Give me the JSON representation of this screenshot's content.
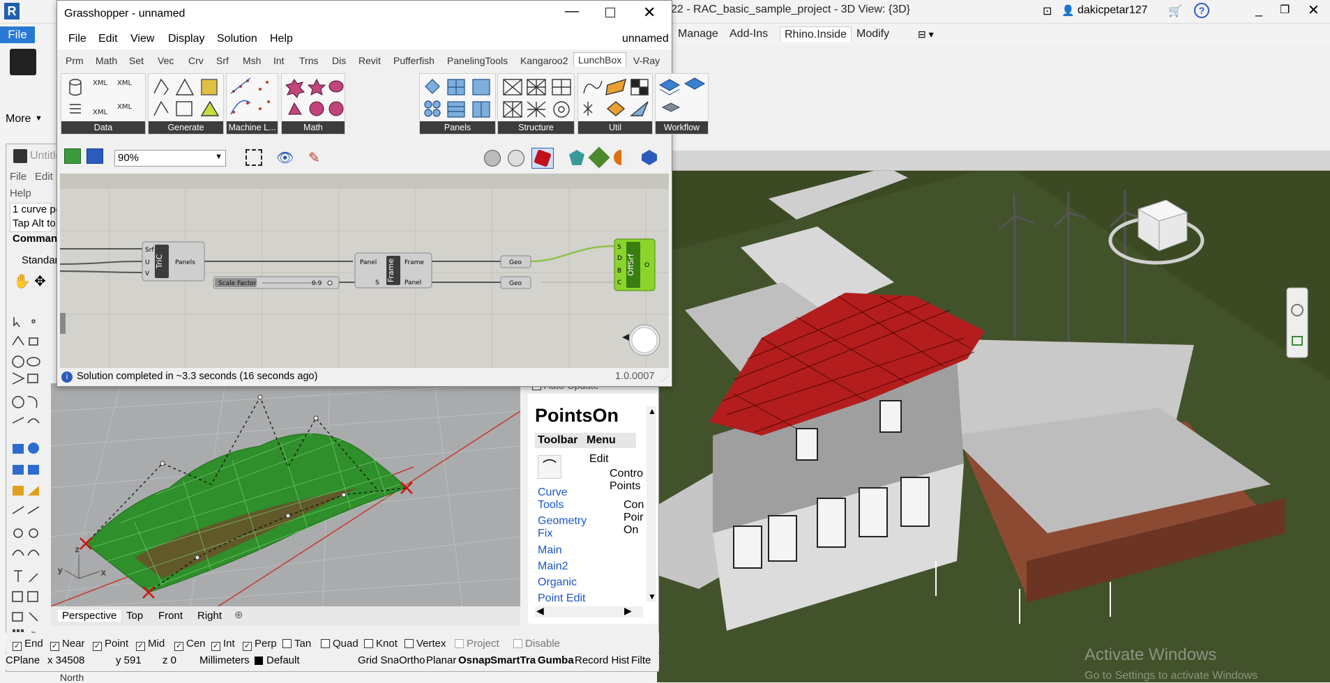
{
  "revit": {
    "title": "22 - RAC_basic_sample_project - 3D View: {3D}",
    "user": "dakicpetar127",
    "file_tab": "File",
    "tabs": [
      "Manage",
      "Add-Ins",
      "Rhino.Inside",
      "Modify"
    ],
    "more": "More",
    "watermark_title": "Activate Windows",
    "watermark_sub": "Go to Settings to activate Windows",
    "bottom_label": "North"
  },
  "gh": {
    "title": "Grasshopper - unnamed",
    "doc_name": "unnamed",
    "menu": [
      "File",
      "Edit",
      "View",
      "Display",
      "Solution",
      "Help"
    ],
    "tabs": [
      "Prm",
      "Math",
      "Set",
      "Vec",
      "Crv",
      "Srf",
      "Msh",
      "Int",
      "Trns",
      "Dis",
      "Revit",
      "Pufferfish",
      "PanelingTools",
      "Kangaroo2",
      "LunchBox",
      "V-Ray"
    ],
    "active_tab": "LunchBox",
    "groups": [
      "Data",
      "Generate",
      "Machine L...",
      "Math",
      "Panels",
      "Structure",
      "Util",
      "Workflow"
    ],
    "zoom": "90%",
    "status": "Solution completed in ~3.3 seconds (16 seconds ago)",
    "version": "1.0.0007",
    "components": {
      "tric": {
        "name": "TriC",
        "inputs": [
          "Srf",
          "U",
          "V"
        ],
        "outputs": [
          "Panels"
        ]
      },
      "slider": {
        "label": "Scale Factor",
        "value": "0.9"
      },
      "frame": {
        "name": "Frame",
        "inputs": [
          "Panel",
          "S"
        ],
        "outputs": [
          "Frame",
          "Panel"
        ]
      },
      "geo1": "Geo",
      "geo2": "Geo",
      "offsrf": {
        "name": "OffSrf",
        "inputs": [
          "S",
          "D",
          "B",
          "C"
        ],
        "outputs": [
          "O"
        ]
      }
    }
  },
  "rhino": {
    "doc_title": "Untitle",
    "menu": [
      "File",
      "Edit",
      "Help"
    ],
    "cmd_lines": [
      "1 curve po",
      "Tap Alt to"
    ],
    "cmd_label": "Comman",
    "toolbar_label": "Standar",
    "viewport_tabs": [
      "Perspective",
      "Top",
      "Front",
      "Right"
    ],
    "osnaps": [
      {
        "label": "End",
        "checked": true
      },
      {
        "label": "Near",
        "checked": true
      },
      {
        "label": "Point",
        "checked": true
      },
      {
        "label": "Mid",
        "checked": true
      },
      {
        "label": "Cen",
        "checked": true
      },
      {
        "label": "Int",
        "checked": true
      },
      {
        "label": "Perp",
        "checked": true
      },
      {
        "label": "Tan",
        "checked": false
      },
      {
        "label": "Quad",
        "checked": false
      },
      {
        "label": "Knot",
        "checked": false
      },
      {
        "label": "Vertex",
        "checked": false
      },
      {
        "label": "Project",
        "checked": false
      },
      {
        "label": "Disable",
        "checked": false
      }
    ],
    "status": {
      "cplane": "CPlane",
      "x": "x 34508",
      "y": "y 591",
      "z": "z 0",
      "units": "Millimeters",
      "layer": "Default",
      "items": [
        "Grid Sna",
        "Ortho",
        "Planar",
        "Osnap",
        "SmartTra",
        "Gumba",
        "Record Hist",
        "Filte"
      ]
    },
    "help": {
      "auto_update": "Auto-Update",
      "title": "PointsOn",
      "col_toolbar": "Toolbar",
      "col_menu": "Menu",
      "menu_items": [
        "Edit",
        "Contro",
        "Points",
        "Con",
        "Poir",
        "On"
      ],
      "links": [
        "Curve Tools",
        "Geometry Fix",
        "Main",
        "Main2",
        "Organic",
        "Point Edit"
      ]
    }
  }
}
